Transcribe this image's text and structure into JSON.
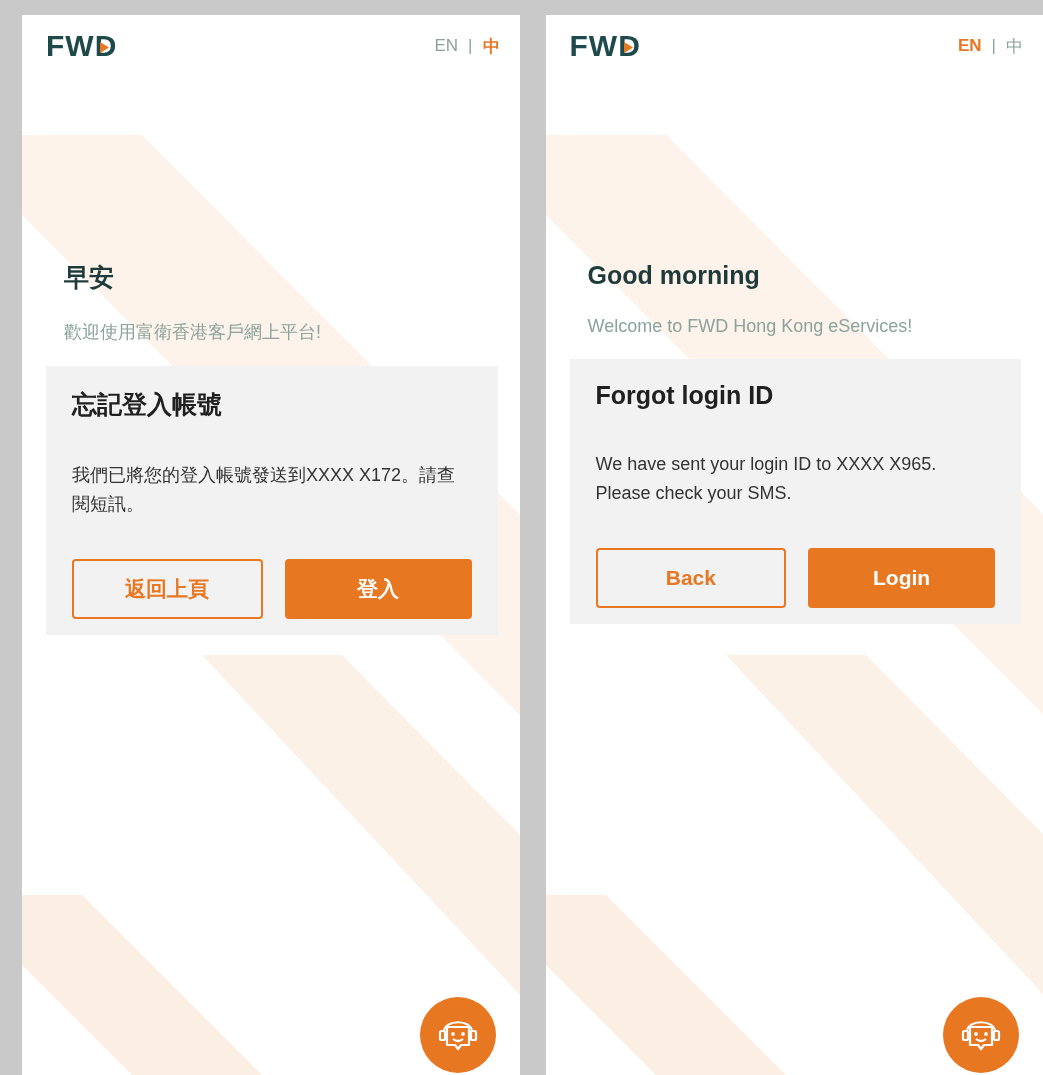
{
  "screens": [
    {
      "logo": "FWD",
      "languages": [
        {
          "label": "EN",
          "selected": false
        },
        {
          "label": "中",
          "selected": true
        }
      ],
      "separator": "|",
      "greeting": "早安",
      "welcome": "歡迎使用富衛香港客戶網上平台!",
      "card": {
        "title": "忘記登入帳號",
        "message": "我們已將您的登入帳號發送到XXXX X172。請查閱短訊。",
        "buttons": [
          {
            "label": "返回上頁",
            "kind": "outline"
          },
          {
            "label": "登入",
            "kind": "primary"
          }
        ]
      }
    },
    {
      "logo": "FWD",
      "languages": [
        {
          "label": "EN",
          "selected": true
        },
        {
          "label": "中",
          "selected": false
        }
      ],
      "separator": "|",
      "greeting": "Good morning",
      "welcome": "Welcome to FWD Hong Kong eServices!",
      "card": {
        "title": "Forgot login ID",
        "message": "We have sent your login ID to XXXX X965. Please check your SMS.",
        "buttons": [
          {
            "label": "Back",
            "kind": "outline"
          },
          {
            "label": "Login",
            "kind": "primary"
          }
        ]
      }
    }
  ]
}
